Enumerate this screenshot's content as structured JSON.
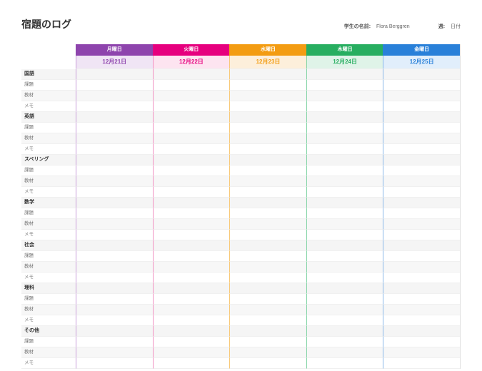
{
  "title": "宿題のログ",
  "meta": {
    "student_label": "学生の名前:",
    "student_value": "Flora Berggren",
    "week_label": "週:",
    "week_value": "日付"
  },
  "days": [
    {
      "name": "月曜日",
      "date": "12月21日"
    },
    {
      "name": "火曜日",
      "date": "12月22日"
    },
    {
      "name": "水曜日",
      "date": "12月23日"
    },
    {
      "name": "木曜日",
      "date": "12月24日"
    },
    {
      "name": "金曜日",
      "date": "12月25日"
    }
  ],
  "row_sub_labels": [
    "課題",
    "教材",
    "メモ"
  ],
  "subjects": [
    {
      "name": "国語",
      "rows": [
        [
          "",
          "",
          "",
          "",
          ""
        ],
        [
          "",
          "",
          "",
          "",
          ""
        ],
        [
          "",
          "",
          "",
          "",
          ""
        ]
      ]
    },
    {
      "name": "英語",
      "rows": [
        [
          "",
          "",
          "",
          "",
          ""
        ],
        [
          "",
          "",
          "",
          "",
          ""
        ],
        [
          "",
          "",
          "",
          "",
          ""
        ]
      ]
    },
    {
      "name": "スペリング",
      "rows": [
        [
          "",
          "",
          "",
          "",
          ""
        ],
        [
          "",
          "",
          "",
          "",
          ""
        ],
        [
          "",
          "",
          "",
          "",
          ""
        ]
      ]
    },
    {
      "name": "数学",
      "rows": [
        [
          "",
          "",
          "",
          "",
          ""
        ],
        [
          "",
          "",
          "",
          "",
          ""
        ],
        [
          "",
          "",
          "",
          "",
          ""
        ]
      ]
    },
    {
      "name": "社会",
      "rows": [
        [
          "",
          "",
          "",
          "",
          ""
        ],
        [
          "",
          "",
          "",
          "",
          ""
        ],
        [
          "",
          "",
          "",
          "",
          ""
        ]
      ]
    },
    {
      "name": "理科",
      "rows": [
        [
          "",
          "",
          "",
          "",
          ""
        ],
        [
          "",
          "",
          "",
          "",
          ""
        ],
        [
          "",
          "",
          "",
          "",
          ""
        ]
      ]
    },
    {
      "name": "その他",
      "rows": [
        [
          "",
          "",
          "",
          "",
          ""
        ],
        [
          "",
          "",
          "",
          "",
          ""
        ],
        [
          "",
          "",
          "",
          "",
          ""
        ]
      ]
    }
  ]
}
